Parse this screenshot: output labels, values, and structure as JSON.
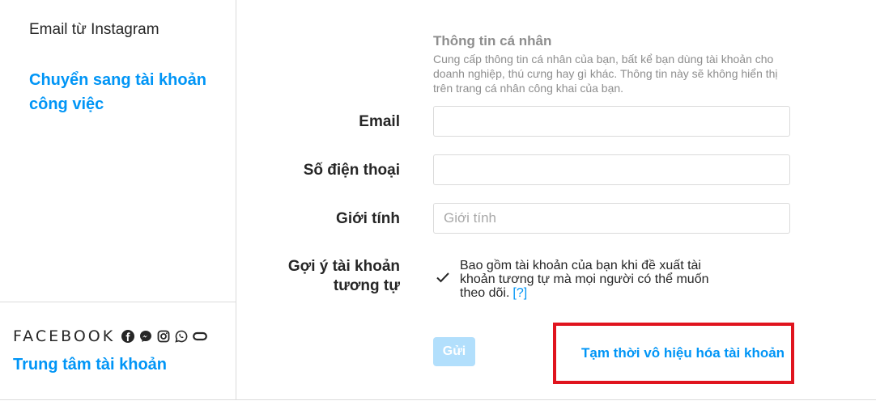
{
  "sidebar": {
    "email_from_instagram": "Email từ Instagram",
    "switch_to_professional": "Chuyển sang tài khoản công việc",
    "meta_brand": "FACEBOOK",
    "brand_icons": [
      "facebook-icon",
      "messenger-icon",
      "instagram-icon",
      "whatsapp-icon",
      "oculus-icon"
    ],
    "accounts_center": "Trung tâm tài khoản"
  },
  "personal_info": {
    "title": "Thông tin cá nhân",
    "description": "Cung cấp thông tin cá nhân của bạn, bất kể bạn dùng tài khoản cho doanh nghiệp, thú cưng hay gì khác. Thông tin này sẽ không hiển thị trên trang cá nhân công khai của bạn."
  },
  "form": {
    "email": {
      "label": "Email",
      "value": "",
      "placeholder": ""
    },
    "phone": {
      "label": "Số điện thoại",
      "value": "",
      "placeholder": ""
    },
    "gender": {
      "label": "Giới tính",
      "value": "",
      "placeholder": "Giới tính"
    },
    "suggestions": {
      "label": "Gợi ý tài khoản tương tự",
      "checked": true,
      "text": "Bao gồm tài khoản của bạn khi đề xuất tài khoản tương tự mà mọi người có thể muốn theo dõi.",
      "help": "[?]"
    },
    "submit_label": "Gửi",
    "deactivate_label": "Tạm thời vô hiệu hóa tài khoản"
  },
  "colors": {
    "link_blue": "#0095f6",
    "disabled_button": "#b2dffc",
    "highlight_red": "#e0141e"
  }
}
